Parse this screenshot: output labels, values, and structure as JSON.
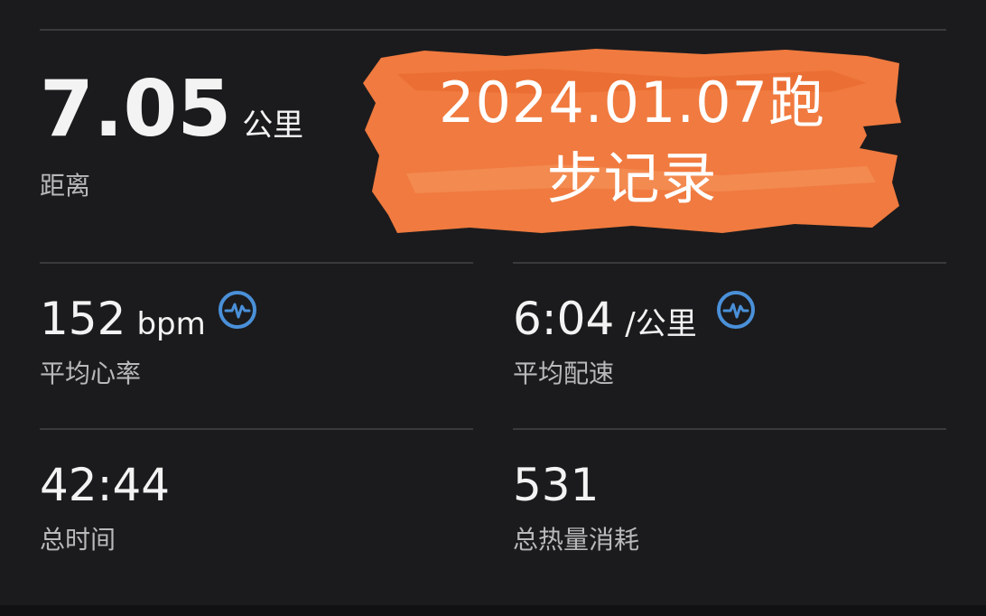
{
  "distance": {
    "value": "7.05",
    "unit": "公里",
    "label": "距离"
  },
  "heart_rate": {
    "value": "152",
    "unit": "bpm",
    "label": "平均心率",
    "icon": "heart-rate-icon"
  },
  "pace": {
    "value": "6:04",
    "unit": "/公里",
    "label": "平均配速",
    "icon": "heart-rate-icon"
  },
  "total_time": {
    "value": "42:44",
    "label": "总时间"
  },
  "calories": {
    "value": "531",
    "label": "总热量消耗"
  },
  "banner": {
    "line1": "2024.01.07跑",
    "line2": "步记录",
    "color": "#f07a3f"
  },
  "colors": {
    "background": "#1b1b1d",
    "divider": "#3a3a3c",
    "icon": "#4a90d9"
  }
}
